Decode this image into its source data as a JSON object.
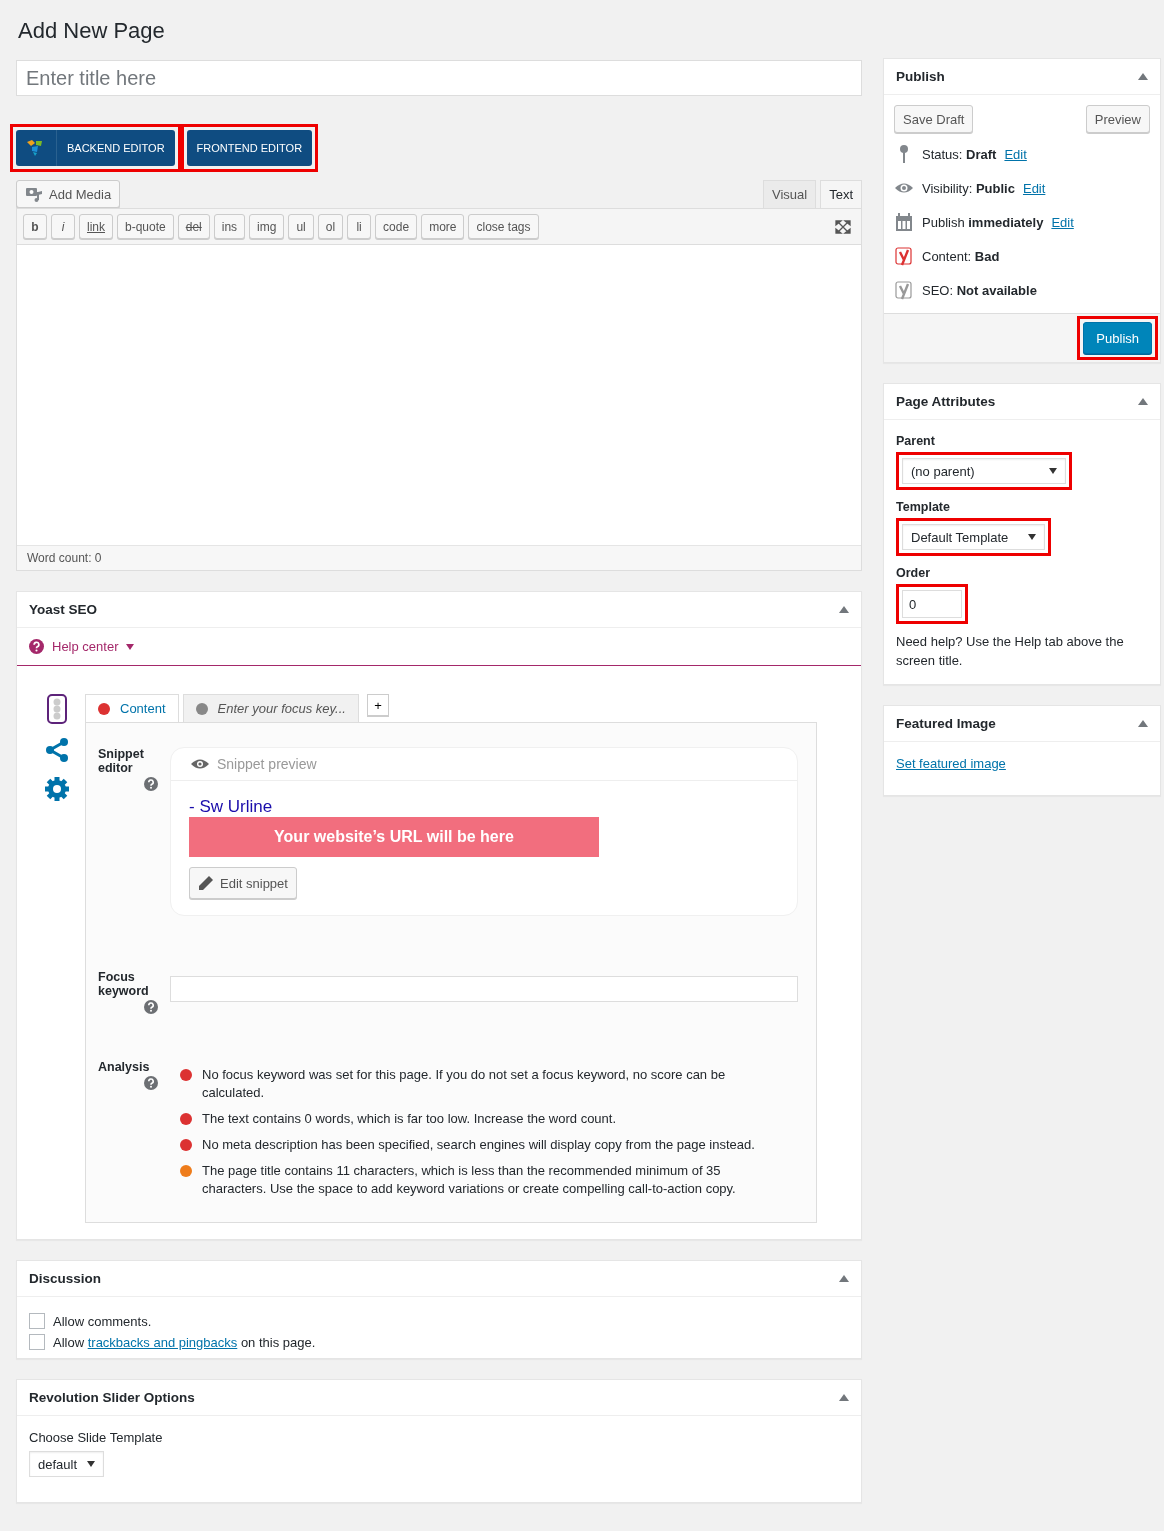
{
  "page_title": "Add New Page",
  "title_field": {
    "placeholder": "Enter title here"
  },
  "builder_buttons": [
    {
      "label": "BACKEND EDITOR",
      "kind": "logo",
      "highlighted": true
    },
    {
      "label": "FRONTEND EDITOR",
      "kind": "plain",
      "highlighted": true
    }
  ],
  "editor": {
    "add_media": "Add Media",
    "tabs": [
      {
        "label": "Visual",
        "selected": false
      },
      {
        "label": "Text",
        "selected": true
      }
    ],
    "quicktags": [
      {
        "label": "b",
        "kind": "bold"
      },
      {
        "label": "i",
        "kind": "italic"
      },
      {
        "label": "link",
        "kind": "link"
      },
      {
        "label": "b-quote",
        "kind": "plain"
      },
      {
        "label": "del",
        "kind": "strike"
      },
      {
        "label": "ins",
        "kind": "plain"
      },
      {
        "label": "img",
        "kind": "plain"
      },
      {
        "label": "ul",
        "kind": "plain"
      },
      {
        "label": "ol",
        "kind": "plain"
      },
      {
        "label": "li",
        "kind": "plain"
      },
      {
        "label": "code",
        "kind": "plain"
      },
      {
        "label": "more",
        "kind": "plain"
      },
      {
        "label": "close tags",
        "kind": "plain"
      }
    ],
    "word_count": "Word count: 0"
  },
  "yoast": {
    "title": "Yoast SEO",
    "help": "Help center",
    "tabs": [
      {
        "label": "Content",
        "color": "#dc3232",
        "selected": true,
        "kind": "content"
      },
      {
        "label": "Enter your focus key...",
        "color": "#888888",
        "selected": false,
        "kind": "keyword"
      }
    ],
    "add_tab": "+",
    "snippet_label": "Snippet editor",
    "snippet_preview": "Snippet preview",
    "snippet_title": "- Sw Urline",
    "snippet_url": "Your website’s URL will be here",
    "edit_snippet": "Edit snippet",
    "focus_label": "Focus keyword",
    "analysis_label": "Analysis",
    "analysis": [
      {
        "text": "No focus keyword was set for this page. If you do not set a focus keyword, no score can be calculated.",
        "color": "#dc3232"
      },
      {
        "text": "The text contains 0 words, which is far too low. Increase the word count.",
        "color": "#dc3232"
      },
      {
        "text": "No meta description has been specified, search engines will display copy from the page instead.",
        "color": "#dc3232"
      },
      {
        "text": "The page title contains 11 characters, which is less than the recommended minimum of 35 characters. Use the space to add keyword variations or create compelling call-to-action copy.",
        "color": "#ee7c1b"
      }
    ]
  },
  "discussion": {
    "title": "Discussion",
    "options": [
      {
        "before": "Allow comments.",
        "checked": false
      },
      {
        "before": "Allow ",
        "link": "trackbacks and pingbacks",
        "after": " on this page.",
        "checked": false
      }
    ]
  },
  "revslider": {
    "title": "Revolution Slider Options",
    "label": "Choose Slide Template",
    "value": "default"
  },
  "publish": {
    "title": "Publish",
    "save_draft": "Save Draft",
    "preview": "Preview",
    "rows": [
      {
        "kind": "status",
        "text": "Status: **Draft**",
        "link": "Edit"
      },
      {
        "kind": "visibility",
        "text": "Visibility: **Public**",
        "link": "Edit"
      },
      {
        "kind": "schedule",
        "text": "Publish **immediately**",
        "link": "Edit"
      },
      {
        "kind": "content",
        "text": "Content: **Bad**"
      },
      {
        "kind": "seo",
        "text": "SEO: **Not available**"
      }
    ],
    "button": "Publish",
    "button_highlighted": true
  },
  "page_attributes": {
    "title": "Page Attributes",
    "parent_label": "Parent",
    "parent": "(no parent)",
    "parent_highlighted": true,
    "template_label": "Template",
    "template": "Default Template",
    "template_highlighted": true,
    "order_label": "Order",
    "order": "0",
    "order_highlighted": true,
    "help": "Need help? Use the Help tab above the screen title."
  },
  "featured_image": {
    "title": "Featured Image",
    "link": "Set featured image"
  }
}
